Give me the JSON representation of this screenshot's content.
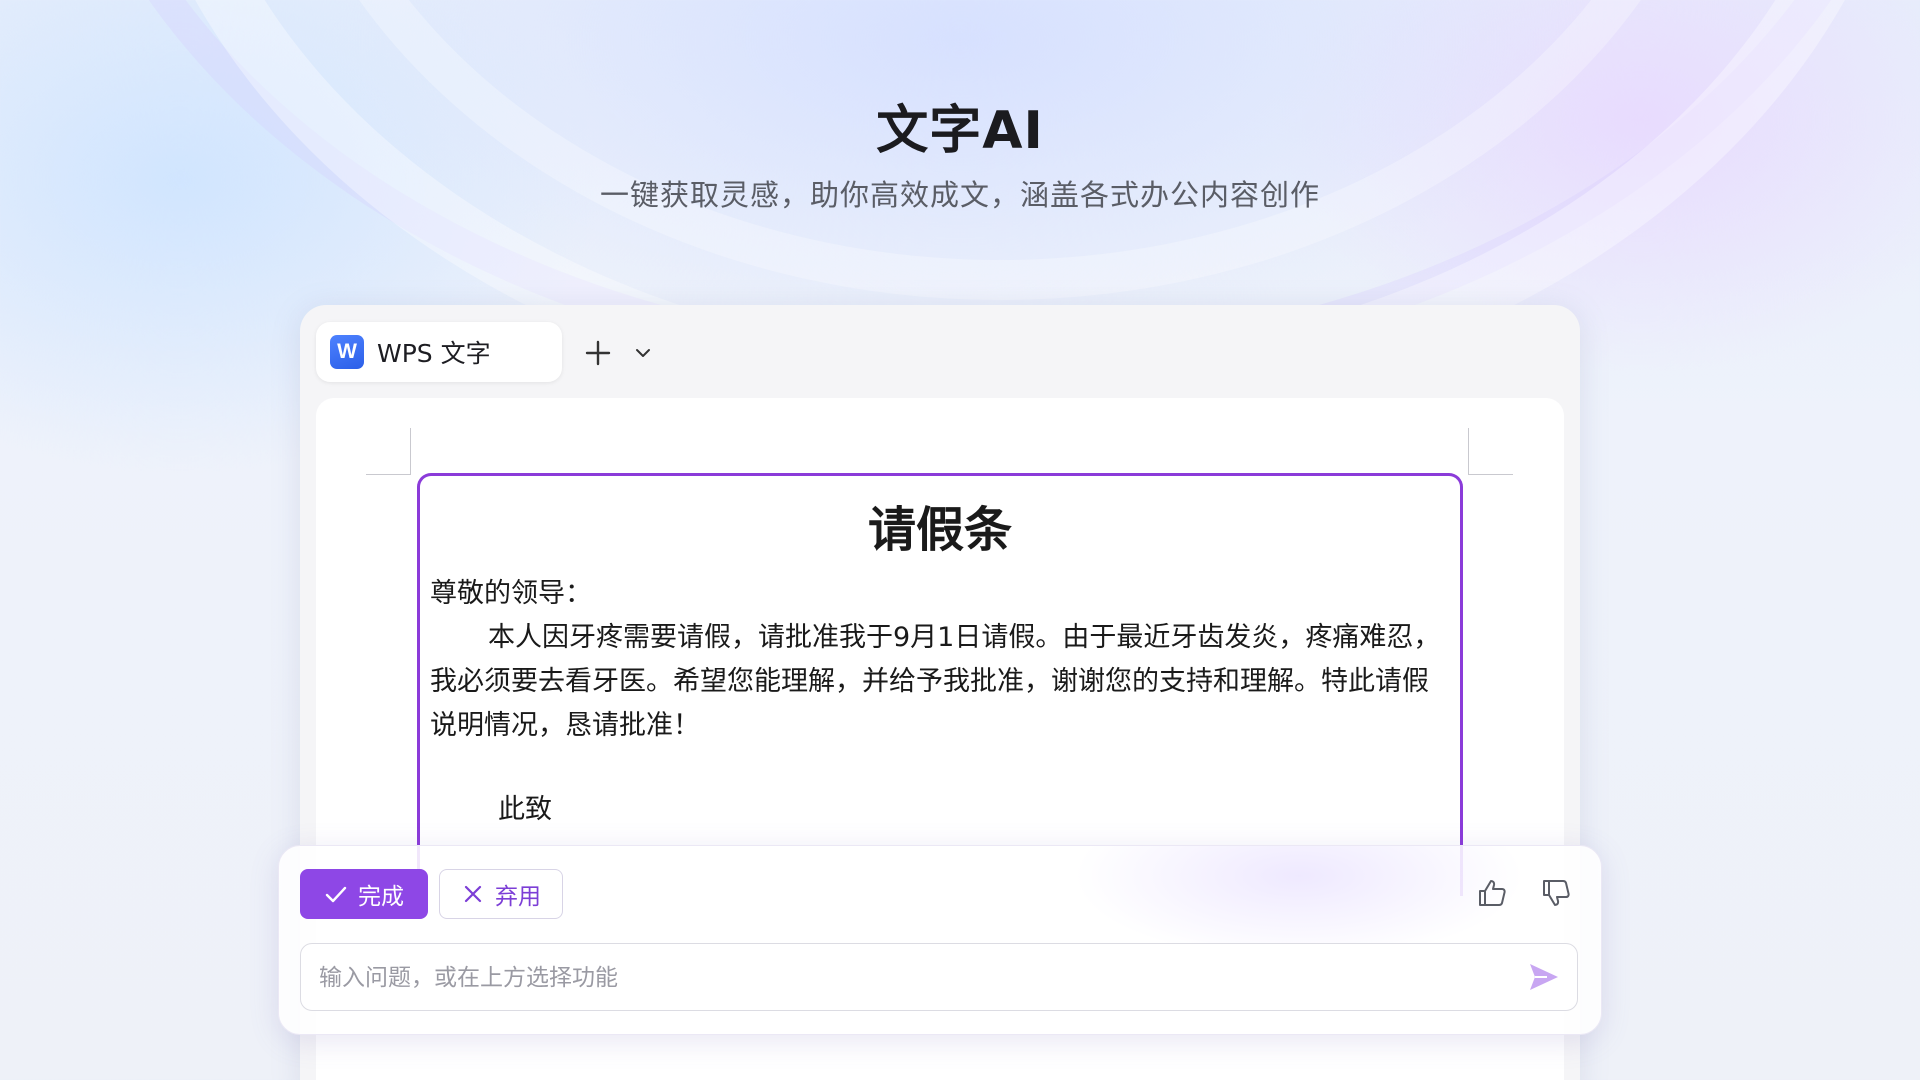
{
  "hero": {
    "title": "文字AI",
    "subtitle": "一键获取灵感，助你高效成文，涵盖各式办公内容创作"
  },
  "window": {
    "tab": {
      "icon_letter": "W",
      "label": "WPS 文字",
      "icon": "wps-writer-icon"
    },
    "new_tab_icon": "plus-icon",
    "tab_menu_icon": "chevron-down-icon"
  },
  "document": {
    "title": "请假条",
    "greeting": "尊敬的领导：",
    "body": "本人因牙疼需要请假，请批准我于9月1日请假。由于最近牙齿发炎，疼痛难忍，我必须要去看牙医。希望您能理解，并给予我批准，谢谢您的支持和理解。特此请假说明情况，恳请批准！",
    "closing": "此致"
  },
  "ai_panel": {
    "done_label": "完成",
    "discard_label": "弃用",
    "prompt_placeholder": "输入问题，或在上方选择功能",
    "prompt_value": ""
  },
  "colors": {
    "accent": "#8e47e6",
    "wps_blue": "#2b5fe8",
    "selection_border": "#8b3bd9"
  }
}
